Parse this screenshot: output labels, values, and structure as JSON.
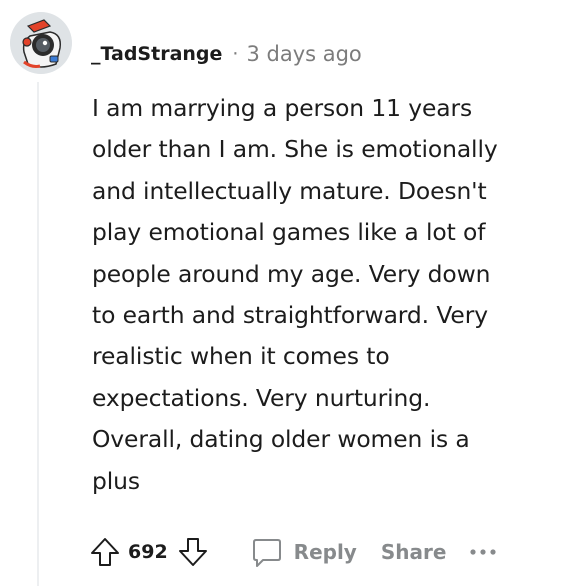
{
  "comment": {
    "author": "_TadStrange",
    "separator": "·",
    "timestamp": "3 days ago",
    "body": "I am marrying a person 11 years\nolder than I am. She is emotionally\nand intellectually mature. Doesn't\nplay emotional games like a lot of\npeople around my age. Very down\nto earth and straightforward. Very\nrealistic when it comes to\nexpectations. Very nurturing.\nOverall, dating older women is a\nplus",
    "score": "692",
    "reply_label": "Reply",
    "share_label": "Share"
  },
  "icons": {
    "avatar": "snoo-avatar",
    "upvote": "upvote-arrow-icon",
    "downvote": "downvote-arrow-icon",
    "reply": "speech-bubble-icon",
    "more": "more-horizontal-icon"
  },
  "colors": {
    "text": "#1c1c1c",
    "meta": "#7c7c7c",
    "action": "#878a8c",
    "thread_line": "#edeff1"
  }
}
